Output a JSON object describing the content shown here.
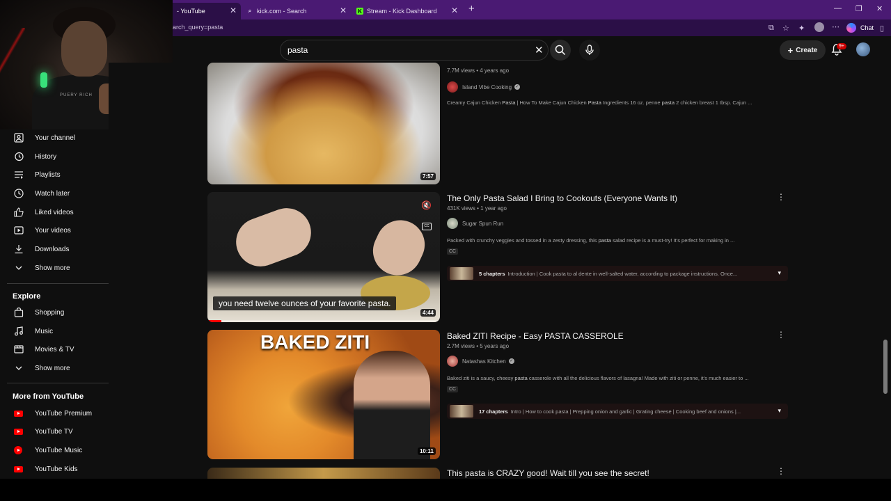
{
  "browser": {
    "tabs": [
      {
        "label": "- YouTube",
        "active": true
      },
      {
        "label": "kick.com - Search",
        "active": false
      },
      {
        "label": "Stream - Kick Dashboard",
        "active": false
      }
    ],
    "url": "arch_query=pasta",
    "chat_label": "Chat",
    "colors": {
      "frame": "#4a1a73",
      "accent": "#53fc18"
    }
  },
  "youtube": {
    "search_query": "pasta",
    "create_label": "Create",
    "notification_badge": "9+"
  },
  "sidebar": {
    "you_items": [
      {
        "label": "Your channel",
        "icon": "user-square-icon"
      },
      {
        "label": "History",
        "icon": "history-icon"
      },
      {
        "label": "Playlists",
        "icon": "playlists-icon"
      },
      {
        "label": "Watch later",
        "icon": "clock-icon"
      },
      {
        "label": "Liked videos",
        "icon": "thumbs-up-icon"
      },
      {
        "label": "Your videos",
        "icon": "play-square-icon"
      },
      {
        "label": "Downloads",
        "icon": "download-icon"
      },
      {
        "label": "Show more",
        "icon": "chevron-down-icon"
      }
    ],
    "explore_heading": "Explore",
    "explore_items": [
      {
        "label": "Shopping",
        "icon": "shopping-bag-icon"
      },
      {
        "label": "Music",
        "icon": "music-note-icon"
      },
      {
        "label": "Movies & TV",
        "icon": "clapperboard-icon"
      },
      {
        "label": "Show more",
        "icon": "chevron-down-icon"
      }
    ],
    "more_heading": "More from YouTube",
    "more_items": [
      {
        "label": "YouTube Premium",
        "icon": "youtube-logo-icon"
      },
      {
        "label": "YouTube TV",
        "icon": "youtube-logo-icon"
      },
      {
        "label": "YouTube Music",
        "icon": "youtube-music-icon"
      },
      {
        "label": "YouTube Kids",
        "icon": "youtube-logo-icon"
      }
    ]
  },
  "webcam": {
    "shirt_text": "PUERY RICH"
  },
  "results": [
    {
      "duration": "7:57",
      "meta": "7.7M views • 4 years ago",
      "channel": "Island Vibe Cooking",
      "verified": true,
      "description_parts": [
        "Creamy Cajun Chicken ",
        "Pasta",
        " | How To Make Cajun Chicken ",
        "Pasta",
        " Ingredients 16 oz. penne ",
        "pasta",
        " 2 chicken breast 1 tbsp. Cajun ..."
      ]
    },
    {
      "title": "The Only Pasta Salad I Bring to Cookouts (Everyone Wants It)",
      "duration": "4:44",
      "meta": "431K views • 1 year ago",
      "channel": "Sugar Spun Run",
      "verified": false,
      "description_parts": [
        "Packed with crunchy veggies and tossed in a zesty dressing, this ",
        "pasta",
        " salad recipe is a must-try! It's perfect for making in ..."
      ],
      "cc": "CC",
      "chapters_count": "5 chapters",
      "chapters_text": "Introduction | Cook pasta to al dente in well-salted water, according to package instructions. Once...",
      "caption": "you need twelve ounces of your favorite pasta.",
      "progress": 0.06
    },
    {
      "title": "Baked ZITI Recipe - Easy PASTA CASSEROLE",
      "thumb_text": "BAKED ZITI",
      "duration": "10:11",
      "meta": "2.7M views • 5 years ago",
      "channel": "Natashas Kitchen",
      "verified": true,
      "description_parts": [
        "Baked ziti is a saucy, cheesy ",
        "pasta",
        " casserole with all the delicious flavors of lasagna! Made with ziti or penne, it's much easier to ..."
      ],
      "cc": "CC",
      "chapters_count": "17 chapters",
      "chapters_text": "Intro | How to cook pasta | Prepping onion and garlic | Grating cheese | Cooking beef and onions |..."
    },
    {
      "title": "This pasta is CRAZY good! Wait till you see the secret!"
    }
  ]
}
